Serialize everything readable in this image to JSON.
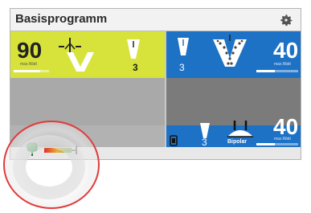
{
  "header": {
    "title": "Basisprogramm",
    "settings_icon": "gear-icon"
  },
  "left_channel": {
    "power": "90",
    "power_label": "max.Watt",
    "power_fraction": 0.75,
    "mode_icon": "cut-electrode-icon",
    "effect_icon": "intensity-icon",
    "effect_level": "3",
    "color": "#d7e33a"
  },
  "right_channel": {
    "power": "40",
    "power_label": "max.Watt",
    "power_fraction": 0.45,
    "effect_icon": "intensity-icon",
    "effect_level": "3",
    "mode_icon": "coag-spray-icon",
    "color": "#1d72c6"
  },
  "bipolar_channel": {
    "power": "40",
    "power_label": "max.Watt",
    "power_fraction": 0.45,
    "effect_icon": "intensity-icon",
    "effect_level": "3",
    "mode_label": "Bipolar",
    "mode_icon": "bipolar-forceps-icon",
    "connector_icon": "socket-icon"
  },
  "status_bar": {
    "footswitch_icon": "footswitch-icon",
    "indicator_icon": "color-scale-icon"
  },
  "colors": {
    "highlight_circle": "#e13a3a"
  }
}
